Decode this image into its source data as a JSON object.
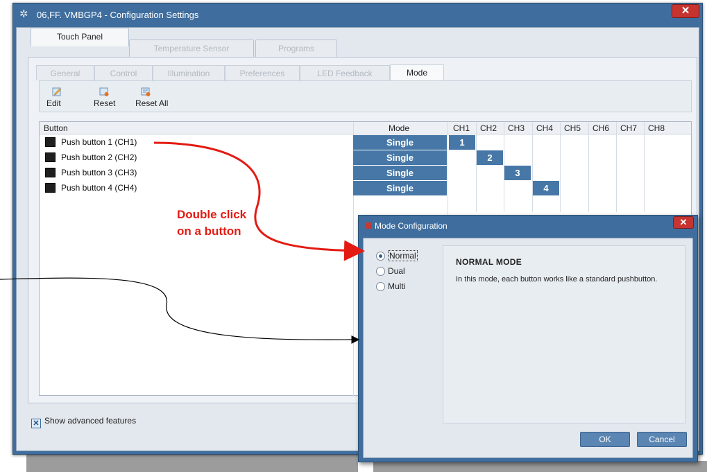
{
  "window": {
    "title": "06,FF. VMBGP4 - Configuration Settings",
    "close_glyph": "✕"
  },
  "top_tabs": [
    "Touch Panel",
    "Temperature Sensor",
    "Programs"
  ],
  "sub_tabs": [
    "General",
    "Control",
    "Illumination",
    "Preferences",
    "LED Feedback",
    "Mode"
  ],
  "toolbar": {
    "edit": "Edit",
    "reset": "Reset",
    "reset_all": "Reset All"
  },
  "grid": {
    "headers": {
      "button": "Button",
      "mode": "Mode",
      "channels": [
        "CH1",
        "CH2",
        "CH3",
        "CH4",
        "CH5",
        "CH6",
        "CH7",
        "CH8"
      ]
    },
    "rows": [
      {
        "name": "Push button 1 (CH1)",
        "mode": "Single",
        "channel": "1"
      },
      {
        "name": "Push button 2 (CH2)",
        "mode": "Single",
        "channel": "2"
      },
      {
        "name": "Push button 3 (CH3)",
        "mode": "Single",
        "channel": "3"
      },
      {
        "name": "Push button 4 (CH4)",
        "mode": "Single",
        "channel": "4"
      }
    ]
  },
  "show_advanced": {
    "label": "Show advanced features",
    "checked": true
  },
  "dialog": {
    "title": "Mode Configuration",
    "options": [
      "Normal",
      "Dual",
      "Multi"
    ],
    "selected": "Normal",
    "heading": "NORMAL MODE",
    "description": "In this mode, each button works like a standard pushbutton.",
    "ok": "OK",
    "cancel": "Cancel"
  },
  "annotation": {
    "line1": "Double click",
    "line2": "on a button",
    "color": "#e31b12"
  },
  "colors": {
    "window_frame": "#3f6e9e",
    "cell_fill": "#4677a6",
    "close_button": "#c7332f"
  }
}
